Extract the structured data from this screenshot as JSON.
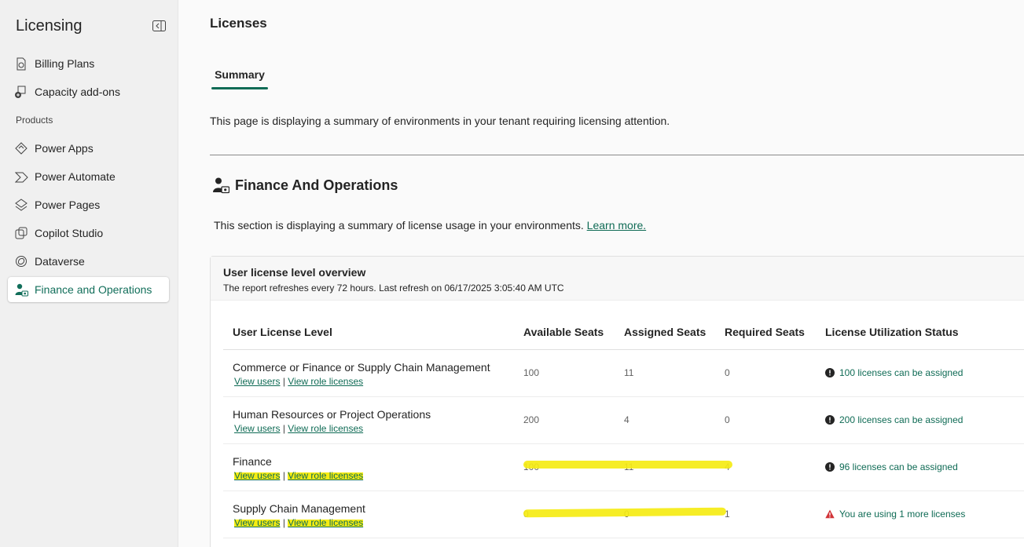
{
  "sidebar": {
    "title": "Licensing",
    "section_label": "Products",
    "items": [
      {
        "label": "Billing Plans",
        "icon": "billing-plans-icon"
      },
      {
        "label": "Capacity add-ons",
        "icon": "capacity-addons-icon"
      },
      {
        "label": "Power Apps",
        "icon": "power-apps-icon"
      },
      {
        "label": "Power Automate",
        "icon": "power-automate-icon"
      },
      {
        "label": "Power Pages",
        "icon": "power-pages-icon"
      },
      {
        "label": "Copilot Studio",
        "icon": "copilot-studio-icon"
      },
      {
        "label": "Dataverse",
        "icon": "dataverse-icon"
      },
      {
        "label": "Finance and Operations",
        "icon": "finance-operations-icon",
        "active": true
      }
    ]
  },
  "main": {
    "title": "Licenses",
    "tabs": [
      {
        "label": "Summary",
        "selected": true
      }
    ],
    "intro": "This page is displaying a summary of environments in your tenant requiring licensing attention.",
    "section": {
      "title": "Finance And Operations",
      "description": "This section is displaying a summary of license usage in your environments.",
      "learn_more": "Learn more."
    },
    "card": {
      "title": "User license level overview",
      "subtitle": "The report refreshes every 72 hours. Last refresh on 06/17/2025 3:05:40 AM UTC",
      "columns": [
        "User License Level",
        "Available Seats",
        "Assigned Seats",
        "Required Seats",
        "License Utilization Status"
      ],
      "link_view_users": "View users",
      "link_separator": "|",
      "link_view_role": "View role licenses",
      "rows": [
        {
          "level": "Commerce or Finance or Supply Chain Management",
          "available": "100",
          "assigned": "11",
          "required": "0",
          "status": "100 licenses can be assigned",
          "status_type": "info"
        },
        {
          "level": "Human Resources or Project Operations",
          "available": "200",
          "assigned": "4",
          "required": "0",
          "status": "200 licenses can be assigned",
          "status_type": "info"
        },
        {
          "level": "Finance",
          "available": "100",
          "assigned": "11",
          "required": "4",
          "status": "96 licenses can be assigned",
          "status_type": "info"
        },
        {
          "level": "Supply Chain Management",
          "available": "0",
          "assigned": "0",
          "required": "1",
          "status": "You are using 1 more licenses",
          "status_type": "warning"
        }
      ]
    }
  },
  "colors": {
    "accent": "#0f6b55",
    "highlight": "#f5ec13",
    "warning": "#d13438"
  }
}
